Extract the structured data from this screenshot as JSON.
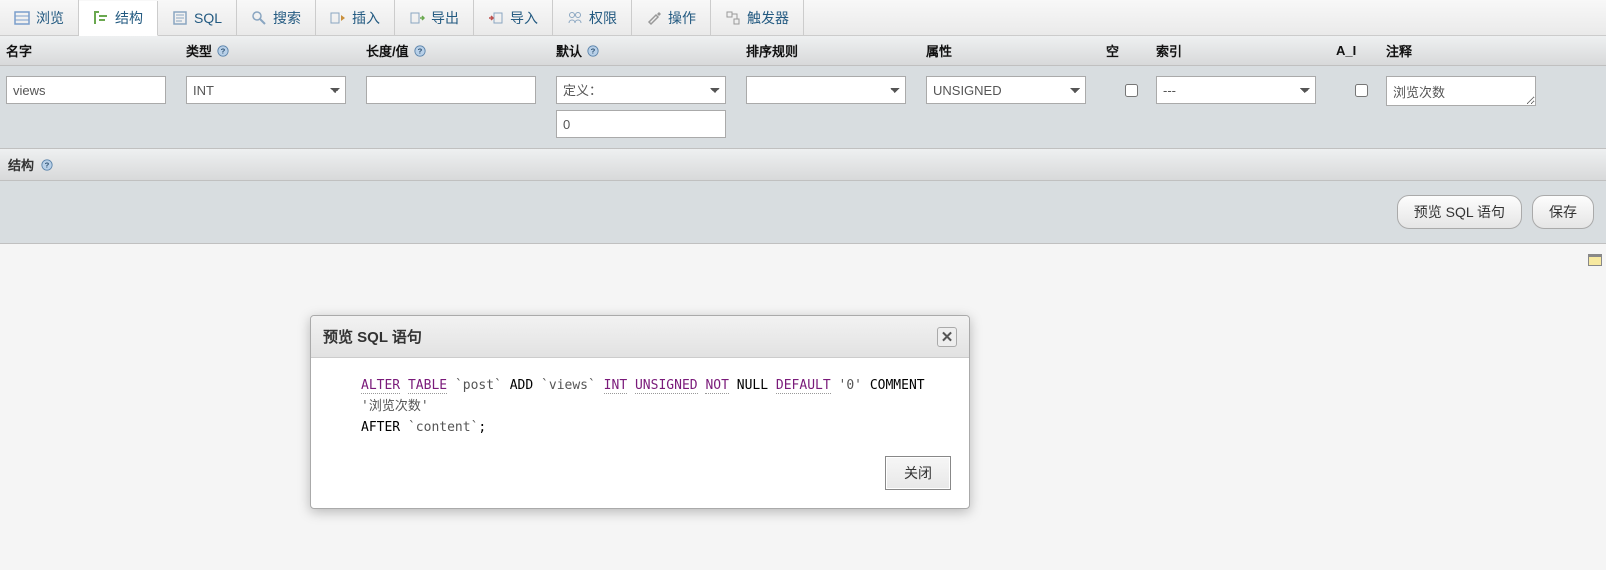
{
  "tabs": [
    {
      "label": "浏览"
    },
    {
      "label": "结构"
    },
    {
      "label": "SQL"
    },
    {
      "label": "搜索"
    },
    {
      "label": "插入"
    },
    {
      "label": "导出"
    },
    {
      "label": "导入"
    },
    {
      "label": "权限"
    },
    {
      "label": "操作"
    },
    {
      "label": "触发器"
    }
  ],
  "columns": {
    "name": "名字",
    "type": "类型",
    "length": "长度/值",
    "default": "默认",
    "collation": "排序规则",
    "attribute": "属性",
    "null": "空",
    "index": "索引",
    "ai": "A_I",
    "comment": "注释"
  },
  "row": {
    "name_value": "views",
    "type_value": "INT",
    "length_value": "",
    "default_select": "定义：",
    "default_text": "0",
    "collation_value": "",
    "attribute_value": "UNSIGNED",
    "null_checked": false,
    "index_value": "---",
    "ai_checked": false,
    "comment_value": "浏览次数"
  },
  "section_title": "结构",
  "buttons": {
    "preview": "预览 SQL 语句",
    "save": "保存"
  },
  "dialog": {
    "title": "预览 SQL 语句",
    "kw_alter": "ALTER",
    "kw_table": "TABLE",
    "bt_post": " `post` ",
    "txt_add": "ADD",
    "bt_views": " `views` ",
    "kw_int": "INT",
    "kw_unsigned": "UNSIGNED",
    "kw_not": "NOT",
    "kw_null": "NULL",
    "kw_default": "DEFAULT",
    "str_zero": " '0' ",
    "txt_comment": "COMMENT",
    "str_comment": " '浏览次数' ",
    "txt_after": "AFTER",
    "bt_content": " `content`",
    "semi": ";",
    "close": "关闭"
  }
}
